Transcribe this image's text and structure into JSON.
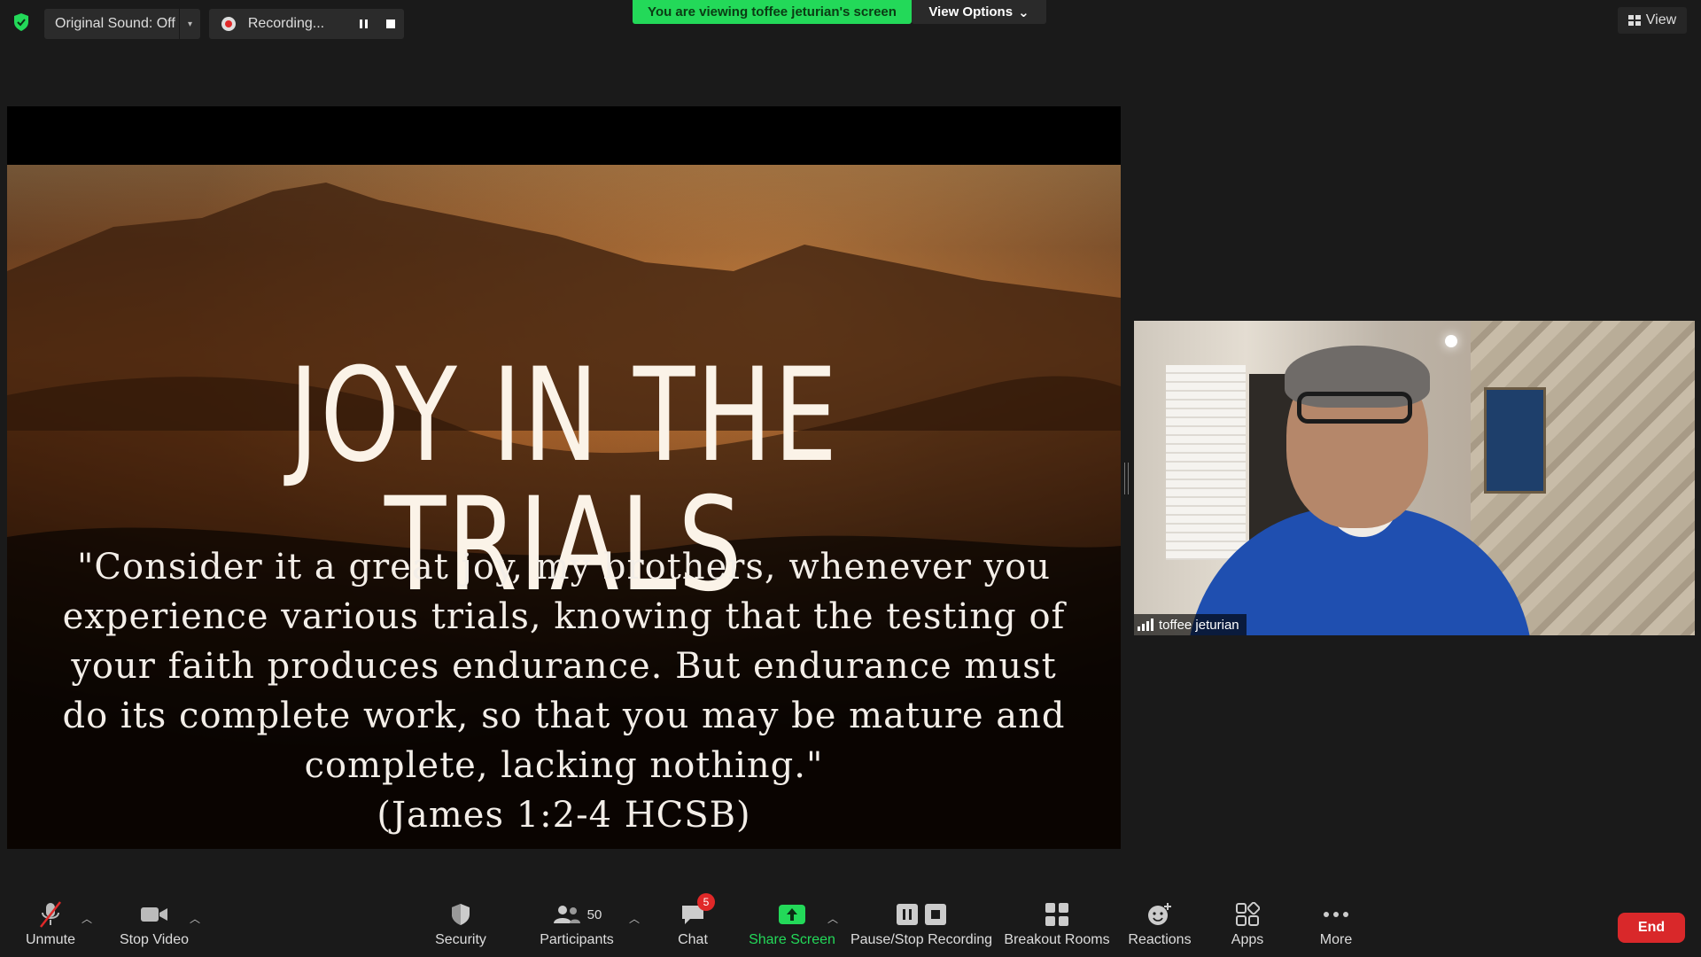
{
  "topbar": {
    "shield_icon": "shield-check-icon",
    "original_sound": "Original Sound: Off",
    "recording_label": "Recording...",
    "viewing_banner": "You are viewing toffee jeturian's screen",
    "view_options": "View Options",
    "view_button": "View",
    "colors": {
      "banner": "#23d959"
    }
  },
  "shared_slide": {
    "title": "JOY IN THE TRIALS",
    "quote_lines": [
      "\"Consider it a great joy, my brothers, whenever you",
      "experience various trials, knowing that the testing of",
      "your faith produces endurance. But endurance must",
      "do its complete work, so that you may be mature and",
      "complete, lacking nothing.\"",
      "(James 1:2-4 HCSB)"
    ]
  },
  "participant": {
    "name": "toffee jeturian"
  },
  "toolbar": {
    "unmute": "Unmute",
    "stop_video": "Stop Video",
    "security": "Security",
    "participants": "Participants",
    "participants_count": "50",
    "chat": "Chat",
    "chat_badge": "5",
    "share_screen": "Share Screen",
    "pause_stop_recording": "Pause/Stop Recording",
    "breakout_rooms": "Breakout Rooms",
    "reactions": "Reactions",
    "apps": "Apps",
    "more": "More",
    "end": "End",
    "colors": {
      "share": "#23d959",
      "end": "#d9282a",
      "badge": "#e02828"
    }
  }
}
